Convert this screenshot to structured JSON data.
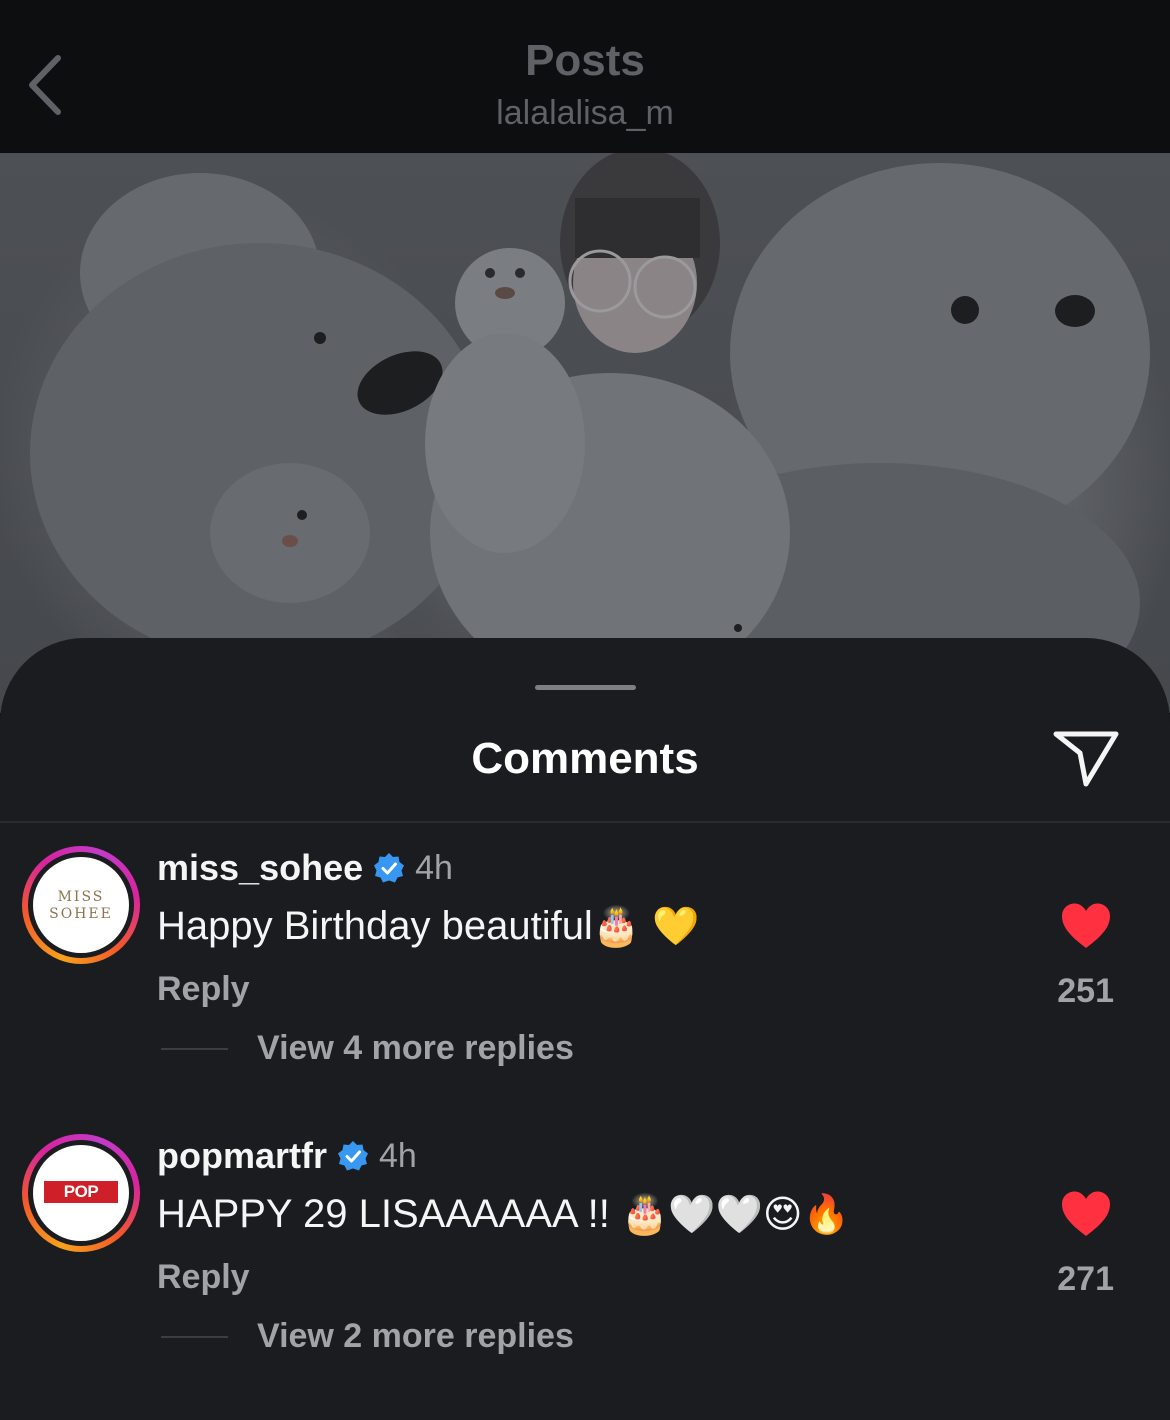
{
  "header": {
    "title": "Posts",
    "subtitle": "lalalalisa_m"
  },
  "sheet": {
    "title": "Comments"
  },
  "comments": [
    {
      "avatar_text": "MISS SOHEE",
      "username": "miss_sohee",
      "time": "4h",
      "text": "Happy Birthday beautiful",
      "emojis": "🎂 💛",
      "reply_label": "Reply",
      "likes": "251",
      "view_more": "View 4 more replies"
    },
    {
      "avatar_text": "POP MART",
      "username": "popmartfr",
      "time": "4h",
      "text": "HAPPY 29 LISAAAAAA !! ",
      "emojis": "🎂🤍🤍😍🔥",
      "reply_label": "Reply",
      "likes": "271",
      "view_more": "View 2 more replies"
    }
  ],
  "colors": {
    "heart": "#ff3040",
    "verified": "#3897f0"
  }
}
